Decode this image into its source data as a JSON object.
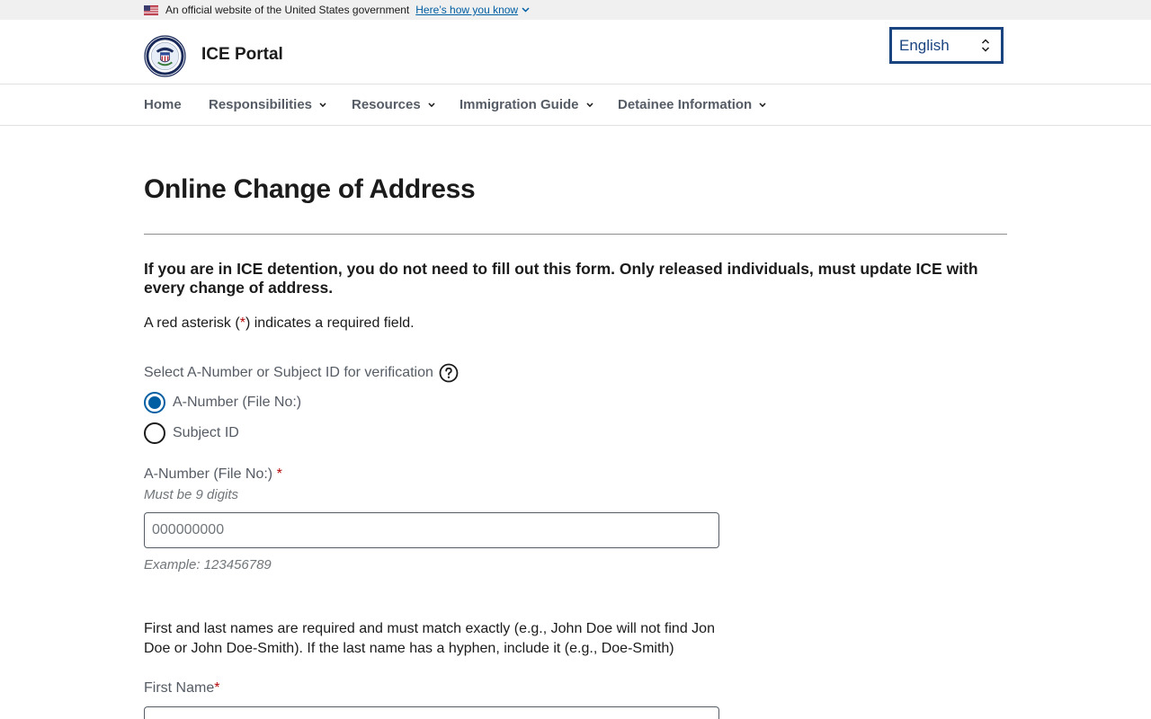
{
  "banner": {
    "text": "An official website of the United States government",
    "link": "Here’s how you know"
  },
  "header": {
    "site_title": "ICE Portal",
    "language": "English"
  },
  "nav": {
    "items": [
      {
        "label": "Home"
      },
      {
        "label": "Responsibilities"
      },
      {
        "label": "Resources"
      },
      {
        "label": "Immigration Guide"
      },
      {
        "label": "Detainee Information"
      }
    ]
  },
  "main": {
    "title": "Online Change of Address",
    "notice": "If you are in ICE detention, you do not need to fill out this form. Only released individuals, must update ICE with every change of address.",
    "required_note": {
      "before": "A red asterisk (",
      "star": "*",
      "after": ") indicates a required field."
    },
    "verification": {
      "label": "Select A-Number or Subject ID for verification",
      "options": [
        {
          "label": "A-Number (File No:)",
          "checked": true
        },
        {
          "label": "Subject ID",
          "checked": false
        }
      ]
    },
    "a_number": {
      "label": "A-Number (File No:)",
      "required_mark": "*",
      "hint": "Must be 9 digits",
      "placeholder": "000000000",
      "value": "",
      "example": "Example: 123456789"
    },
    "names_note": "First and last names are required and must match exactly (e.g., John Doe will not find Jon Doe or John Doe-Smith). If the last name has a hyphen, include it (e.g., Doe-Smith)",
    "first_name": {
      "label": "First Name",
      "required_mark": "*",
      "value": ""
    }
  },
  "colors": {
    "link": "#005ea2",
    "nav_text": "#565c65",
    "required": "#b50909",
    "select_border": "#1a4480",
    "banner_bg": "#f0f0f0"
  },
  "icons": {
    "flag": "us-flag-icon",
    "logo": "dhs-seal-logo",
    "help": "question-circle-icon",
    "chevron": "chevron-down-icon",
    "select": "up-down-arrows-icon"
  }
}
